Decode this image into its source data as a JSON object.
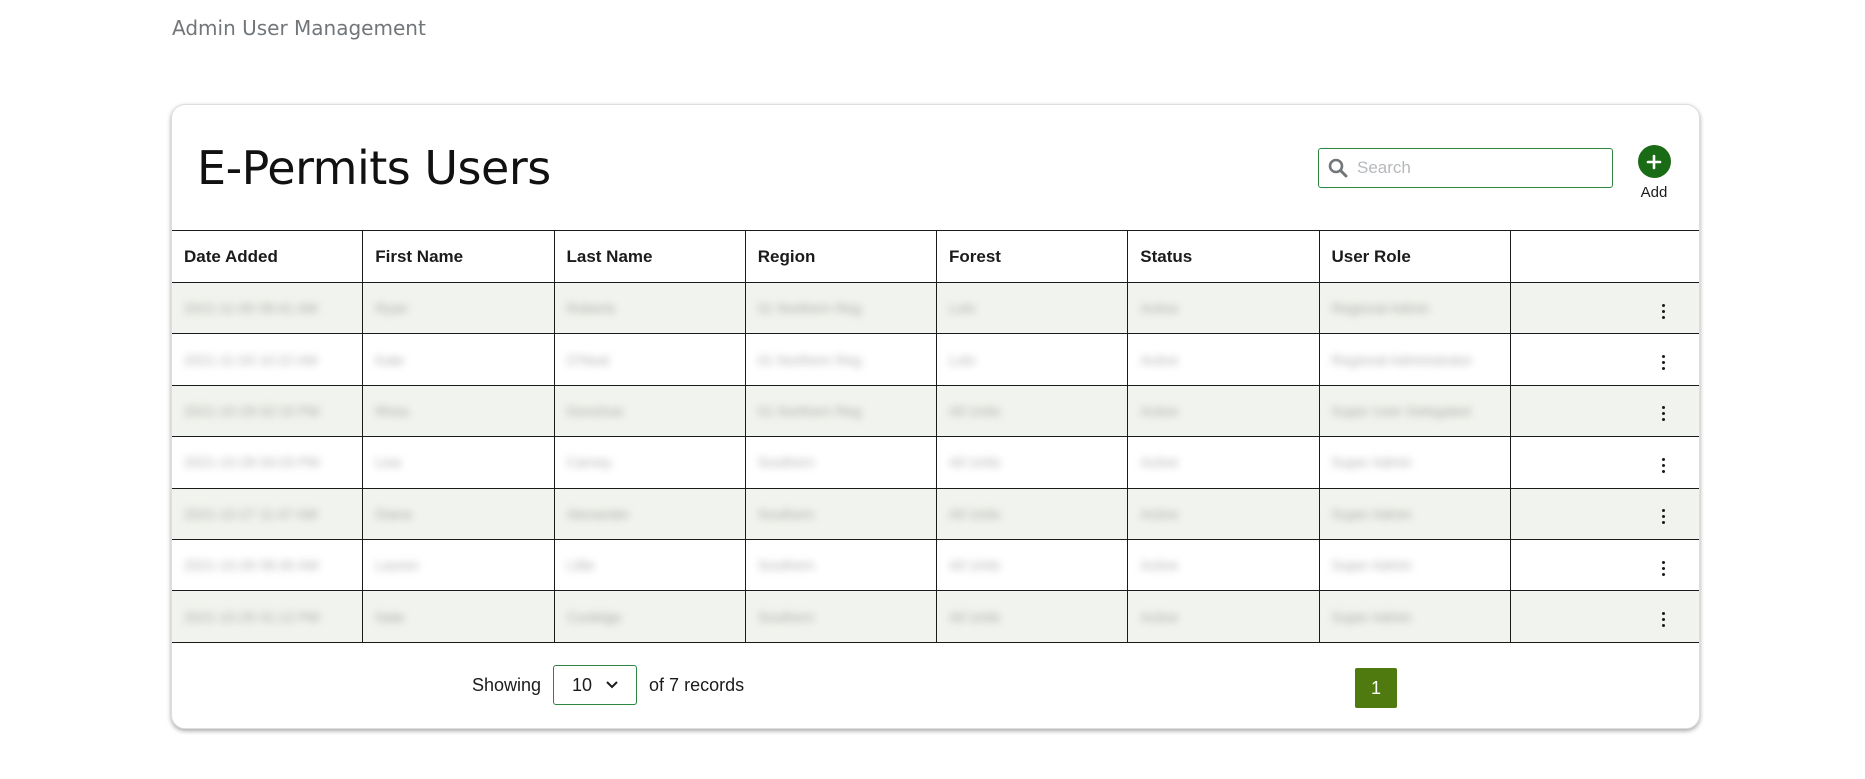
{
  "page": {
    "heading": "Admin User Management"
  },
  "card": {
    "title": "E-Permits Users",
    "search": {
      "placeholder": "Search",
      "value": "",
      "icon": "search-icon"
    },
    "add": {
      "label": "Add",
      "icon": "plus-icon",
      "color": "#1a6b15"
    }
  },
  "table": {
    "columns": [
      "Date Added",
      "First Name",
      "Last Name",
      "Region",
      "Forest",
      "Status",
      "User Role",
      ""
    ],
    "rows": [
      [
        "2021-11-05 09:41 AM",
        "Ryan",
        "Roberts",
        "01 Northern Reg",
        "Lolo",
        "Active",
        "Regional Admin"
      ],
      [
        "2021-11-03 10:22 AM",
        "Kate",
        "O'Neal",
        "01 Northern Reg",
        "Lolo",
        "Active",
        "Regional Administrator"
      ],
      [
        "2021-10-29 02:15 PM",
        "Rhea",
        "Donohue",
        "01 Northern Reg",
        "All Units",
        "Active",
        "Super User Delegated"
      ],
      [
        "2021-10-28 04:03 PM",
        "Lisa",
        "Carney",
        "Southern",
        "All Units",
        "Active",
        "Super Admin"
      ],
      [
        "2021-10-27 11:47 AM",
        "Diana",
        "Alexander",
        "Southern",
        "All Units",
        "Active",
        "Super Admin"
      ],
      [
        "2021-10-26 08:30 AM",
        "Lauren",
        "Lillie",
        "Southern",
        "All Units",
        "Active",
        "Super Admin"
      ],
      [
        "2021-10-25 01:12 PM",
        "Nate",
        "Coolidge",
        "Southern",
        "All Units",
        "Active",
        "Super Admin"
      ]
    ],
    "row_action_icon": "kebab-menu-icon"
  },
  "footer": {
    "showing_label": "Showing",
    "page_size": "10",
    "records_label": "of 7 records",
    "current_page": "1",
    "page_color": "#4f7a0f"
  }
}
